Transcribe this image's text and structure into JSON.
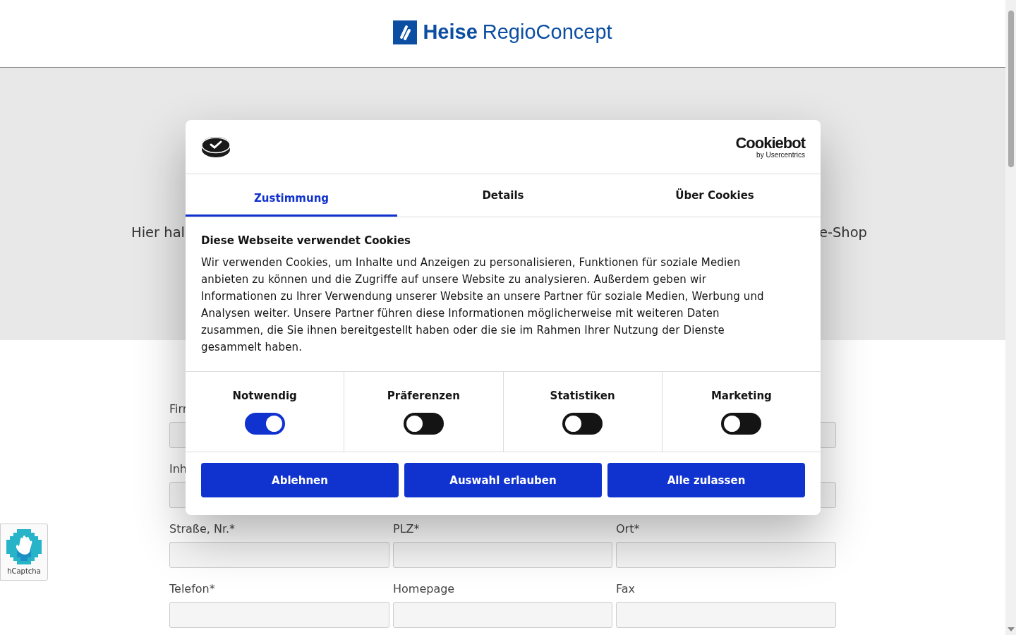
{
  "header": {
    "logo": {
      "brand": "Heise",
      "product": "RegioConcept"
    }
  },
  "hero": {
    "text_left": "Hier hal",
    "text_right": "e-Shop"
  },
  "form": {
    "rows": [
      {
        "fields": [
          {
            "kind": "field",
            "label": "Firr"
          },
          {
            "kind": "covered"
          },
          {
            "kind": "field"
          }
        ]
      },
      {
        "fields": [
          {
            "kind": "field",
            "label": "Inh"
          },
          {
            "kind": "covered"
          },
          {
            "kind": "field"
          }
        ]
      },
      {
        "fields": [
          {
            "kind": "field",
            "label": "Straße, Nr.*"
          },
          {
            "kind": "field",
            "label": "PLZ*"
          },
          {
            "kind": "field",
            "label": "Ort*"
          }
        ]
      },
      {
        "fields": [
          {
            "kind": "field",
            "label": "Telefon*"
          },
          {
            "kind": "field",
            "label": "Homepage"
          },
          {
            "kind": "field",
            "label": "Fax"
          }
        ]
      }
    ]
  },
  "captcha_badge": {
    "label": "hCaptcha"
  },
  "cookie_dialog": {
    "brand": {
      "name": "Cookiebot",
      "byline": "by Usercentrics"
    },
    "tabs": [
      {
        "label": "Zustimmung",
        "selected": true
      },
      {
        "label": "Details",
        "selected": false
      },
      {
        "label": "Über Cookies",
        "selected": false
      }
    ],
    "title": "Diese Webseite verwendet Cookies",
    "text": "Wir verwenden Cookies, um Inhalte und Anzeigen zu personalisieren, Funktionen für soziale Medien anbieten zu können und die Zugriffe auf unsere Website zu analysieren. Außerdem geben wir Informationen zu Ihrer Verwendung unserer Website an unsere Partner für soziale Medien, Werbung und Analysen weiter. Unsere Partner führen diese Informationen möglicherweise mit weiteren Daten zusammen, die Sie ihnen bereitgestellt haben oder die sie im Rahmen Ihrer Nutzung der Dienste gesammelt haben.",
    "categories": [
      {
        "label": "Notwendig",
        "checked": true
      },
      {
        "label": "Präferenzen",
        "checked": false
      },
      {
        "label": "Statistiken",
        "checked": false
      },
      {
        "label": "Marketing",
        "checked": false
      }
    ],
    "buttons": [
      "Ablehnen",
      "Auswahl erlauben",
      "Alle zulassen"
    ]
  }
}
